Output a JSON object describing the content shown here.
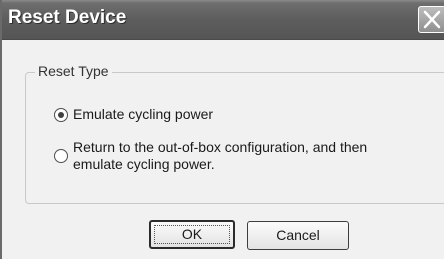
{
  "window": {
    "title": "Reset Device",
    "close_icon": "close-icon"
  },
  "group": {
    "legend": "Reset Type"
  },
  "options": [
    {
      "label": "Emulate cycling power",
      "selected": true
    },
    {
      "label_line1": "Return to the out-of-box configuration, and then",
      "label_line2": "emulate cycling power.",
      "selected": false
    }
  ],
  "buttons": {
    "ok_label": "OK",
    "cancel_label": "Cancel"
  }
}
